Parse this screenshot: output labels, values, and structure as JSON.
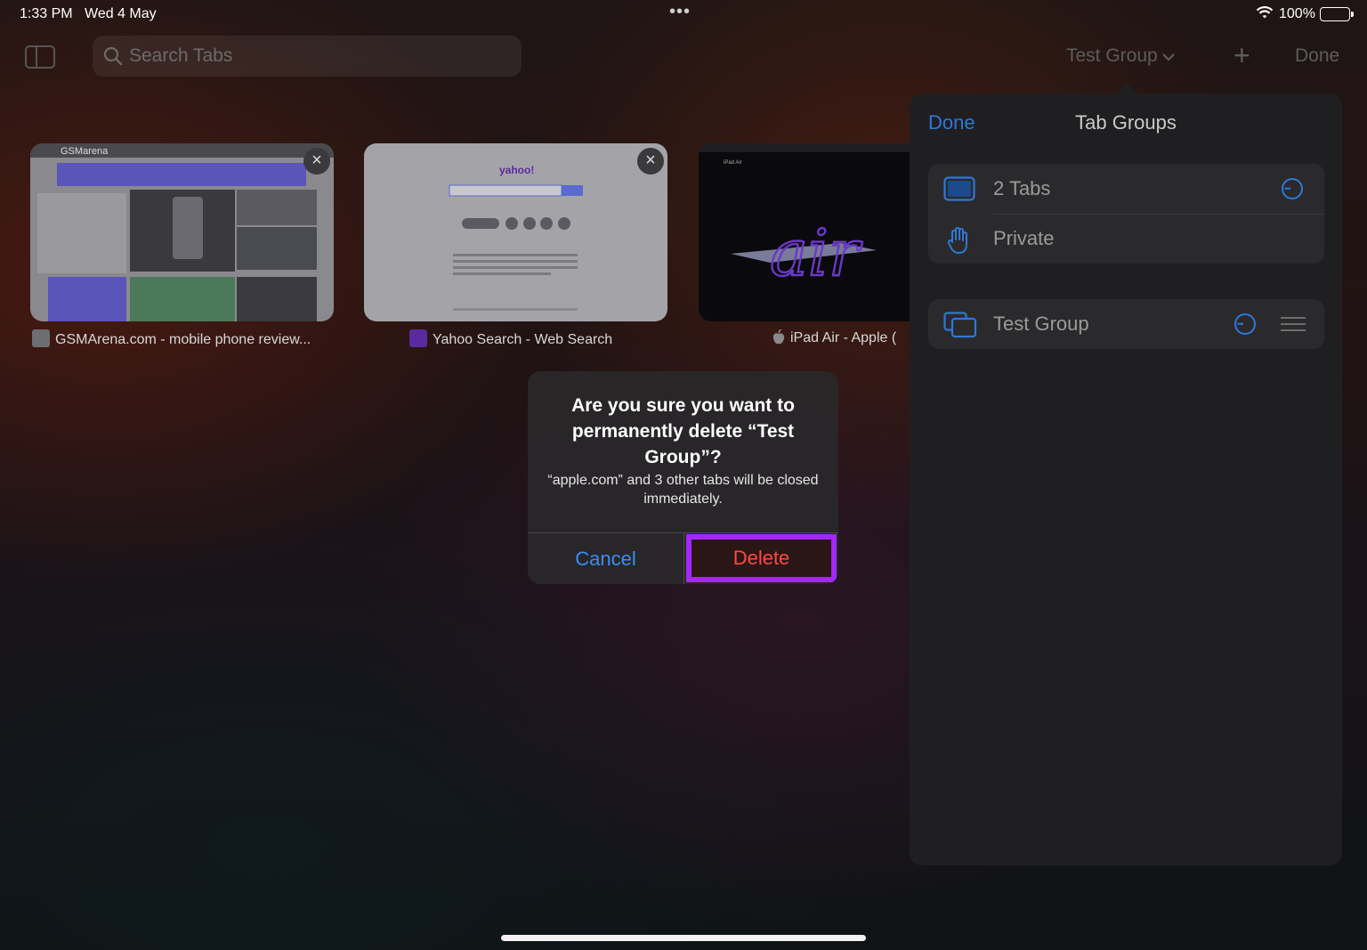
{
  "status": {
    "time": "1:33 PM",
    "date": "Wed 4 May",
    "battery": "100%"
  },
  "toolbar": {
    "search_placeholder": "Search Tabs",
    "group_selector": "Test Group",
    "done": "Done"
  },
  "tabs": [
    {
      "title": "GSMArena.com - mobile phone review..."
    },
    {
      "title": "Yahoo Search - Web Search"
    },
    {
      "title": "iPad Air - Apple ("
    }
  ],
  "thumb_text": {
    "gsm_logo": "GSMarena",
    "yahoo_logo": "yahoo!",
    "ipad_label": "iPad Air",
    "air_text": "air"
  },
  "panel": {
    "done": "Done",
    "title": "Tab Groups",
    "rows": [
      {
        "label": "2 Tabs"
      },
      {
        "label": "Private"
      }
    ],
    "groups": [
      {
        "label": "Test Group"
      }
    ]
  },
  "alert": {
    "title": "Are you sure you want to permanently delete “Test Group”?",
    "message": "“apple.com” and 3 other tabs will be closed immediately.",
    "cancel": "Cancel",
    "delete": "Delete"
  },
  "colors": {
    "accent_blue": "#2f78d6",
    "destructive_red": "#ff4a3d",
    "highlight_purple": "#a228ff"
  }
}
